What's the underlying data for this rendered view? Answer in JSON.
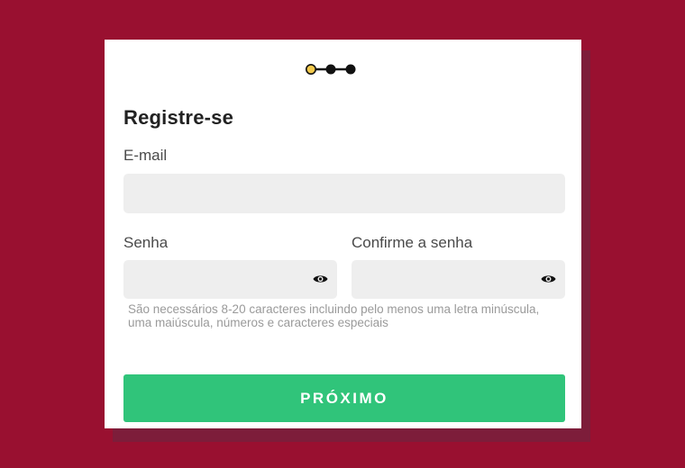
{
  "app": {
    "colors": {
      "background": "#991030",
      "card": "#ffffff",
      "field": "#eeeeee",
      "primary_button": "#30c47a",
      "step_active": "#f2c94c",
      "step_inactive": "#111111"
    }
  },
  "stepper": {
    "total_steps": 3,
    "current_step": 1,
    "icon": "progress-steps"
  },
  "form": {
    "title": "Registre-se",
    "email": {
      "label": "E-mail",
      "value": "",
      "placeholder": ""
    },
    "password": {
      "label": "Senha",
      "value": "",
      "placeholder": "",
      "toggle_icon": "eye-icon"
    },
    "confirm_password": {
      "label": "Confirme a senha",
      "value": "",
      "placeholder": "",
      "toggle_icon": "eye-icon"
    },
    "hint": "São necessários 8-20 caracteres incluindo pelo menos uma letra minúscula, uma maiúscula, números e caracteres especiais",
    "submit_label": "PRÓXIMO"
  }
}
